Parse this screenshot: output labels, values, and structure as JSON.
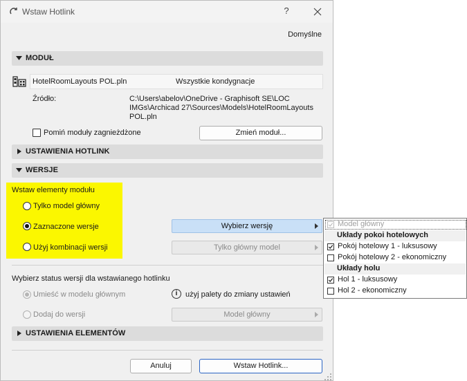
{
  "window": {
    "title": "Wstaw Hotlink",
    "help_label": "?",
    "preset": "Domyślne"
  },
  "sections": {
    "module": "MODUŁ",
    "hotlink_settings": "USTAWIENIA HOTLINK",
    "versions": "WERSJE",
    "element_settings": "USTAWIENIA ELEMENTÓW"
  },
  "module": {
    "file_name": "HotelRoomLayouts POL.pln",
    "stories": "Wszystkie kondygnacje",
    "source_label": "Źródło:",
    "source_lines": [
      "C:\\Users\\abelov\\OneDrive - Graphisoft SE\\LOC",
      "IMGs\\Archicad 27\\Sources\\Models\\HotelRoomLayouts",
      "POL.pln"
    ],
    "skip_nested_label": "Pomiń moduły zagnieżdżone",
    "skip_nested_checked": false,
    "change_module_label": "Zmień moduł..."
  },
  "versions": {
    "insert_label": "Wstaw elementy modułu",
    "options": [
      {
        "label": "Tylko model główny",
        "checked": false
      },
      {
        "label": "Zaznaczone wersje",
        "checked": true
      },
      {
        "label": "Użyj kombinacji wersji",
        "checked": false
      }
    ],
    "choose_version_label": "Wybierz wersję",
    "main_model_only_label": "Tylko główny model",
    "status_label": "Wybierz status wersji dla wstawianego hotlinku",
    "status_options": [
      {
        "label": "Umieść w modelu głównym",
        "checked": true
      },
      {
        "label": "Dodaj do wersji",
        "checked": false
      }
    ],
    "palette_info": "użyj palety do zmiany ustawień",
    "main_model_label": "Model główny"
  },
  "buttons": {
    "cancel": "Anuluj",
    "insert": "Wstaw Hotlink..."
  },
  "version_menu": {
    "main_model": {
      "label": "Model główny",
      "checked": true
    },
    "groups": [
      {
        "title": "Układy pokoi hotelowych",
        "items": [
          {
            "label": "Pokój hotelowy 1 - luksusowy",
            "checked": true
          },
          {
            "label": "Pokój hotelowy 2 - ekonomiczny",
            "checked": false
          }
        ]
      },
      {
        "title": "Układy holu",
        "items": [
          {
            "label": "Hol 1 - luksusowy",
            "checked": true
          },
          {
            "label": "Hol 2 - ekonomiczny",
            "checked": false
          }
        ]
      }
    ]
  },
  "icons": {
    "app": "refresh-icon",
    "close": "close-icon",
    "module_file": "module-file-icon",
    "info": "info-icon",
    "check": "check-icon",
    "expand": "triangle-down-icon",
    "collapsed": "triangle-right-icon"
  },
  "colors": {
    "highlight": "#fbf700",
    "active_popup": "#c9e0f7",
    "primary_border": "#2a64c4",
    "section_bg": "#dcdcdc"
  }
}
